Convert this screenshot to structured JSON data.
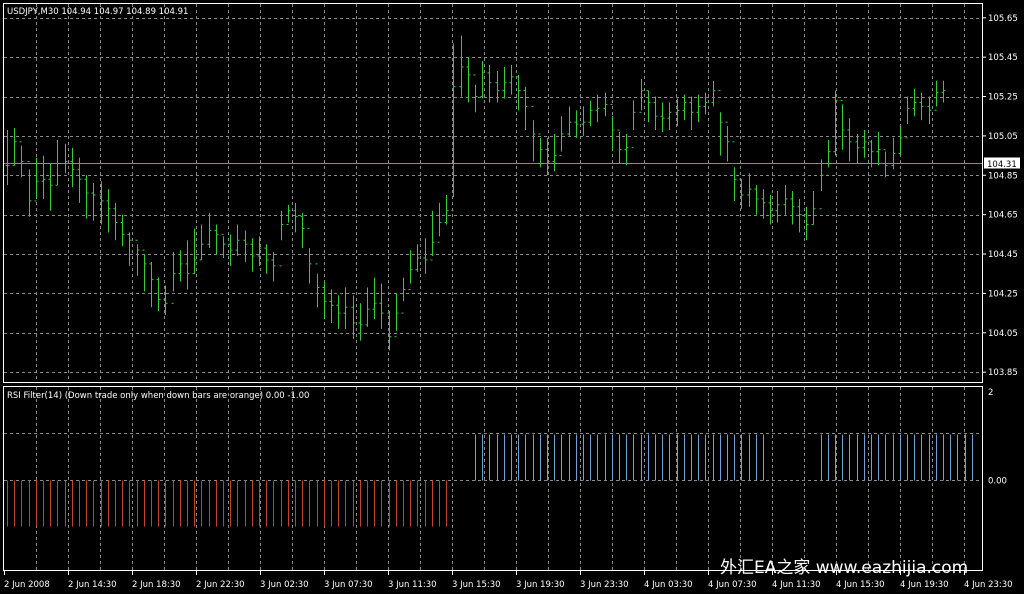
{
  "main_header": "USDJPY,M30  104.94 104.97 104.89 104.91",
  "indicator_header": "RSI Filter(14)  (Down trade only when down bars are orange) 0.00 -1.00",
  "current_price_label": "104.31",
  "watermark": "外汇EA之家 www.eazhijia.com",
  "colors": {
    "background": "#000000",
    "grid": "#8a8a8a",
    "price_bars": "#32cd32",
    "current_price_line": "#7a8fa0",
    "indicator_up": "#6fa3d8",
    "indicator_down": "#c0442a",
    "text": "#ffffff"
  },
  "chart_data": [
    {
      "type": "ohlc",
      "symbol": "USDJPY",
      "timeframe": "M30",
      "ylim": [
        103.8,
        105.72
      ],
      "y_ticks": [
        "105.65",
        "105.45",
        "105.25",
        "105.05",
        "104.85",
        "104.65",
        "104.45",
        "104.25",
        "104.05",
        "103.85"
      ],
      "x_ticks": [
        "2 Jun 2008",
        "2 Jun 14:30",
        "2 Jun 18:30",
        "2 Jun 22:30",
        "3 Jun 02:30",
        "3 Jun 07:30",
        "3 Jun 11:30",
        "3 Jun 15:30",
        "3 Jun 19:30",
        "3 Jun 23:30",
        "4 Jun 03:30",
        "4 Jun 07:30",
        "4 Jun 11:30",
        "4 Jun 15:30",
        "4 Jun 19:30",
        "4 Jun 23:30"
      ],
      "current_price": 104.91,
      "grid": true,
      "close": [
        104.9,
        105.02,
        104.92,
        104.72,
        104.82,
        104.83,
        104.8,
        104.91,
        104.92,
        104.88,
        104.83,
        104.76,
        104.75,
        104.72,
        104.68,
        104.61,
        104.55,
        104.52,
        104.47,
        104.4,
        104.32,
        104.22,
        104.2,
        104.35,
        104.4,
        104.35,
        104.42,
        104.5,
        104.57,
        104.55,
        104.5,
        104.47,
        104.52,
        104.5,
        104.44,
        104.48,
        104.42,
        104.39,
        104.6,
        104.67,
        104.64,
        104.58,
        104.4,
        104.28,
        104.21,
        104.19,
        104.15,
        104.18,
        104.1,
        104.09,
        104.17,
        104.2,
        104.15,
        104.03,
        104.15,
        104.27,
        104.37,
        104.43,
        104.42,
        104.51,
        104.61,
        104.67,
        105.3,
        105.4,
        105.36,
        105.25,
        105.37,
        105.32,
        105.28,
        105.32,
        105.35,
        105.28,
        105.2,
        105.06,
        104.98,
        104.92,
        104.95,
        105.06,
        105.12,
        105.11,
        105.12,
        105.18,
        105.19,
        105.21,
        105.08,
        104.98,
        104.99,
        105.17,
        105.28,
        105.22,
        105.15,
        105.14,
        105.17,
        105.18,
        105.22,
        105.17,
        105.2,
        105.22,
        105.28,
        105.12,
        105.02,
        104.83,
        104.75,
        104.78,
        104.73,
        104.71,
        104.67,
        104.7,
        104.73,
        104.69,
        104.65,
        104.6,
        104.68,
        104.85,
        104.97,
        105.23,
        105.08,
        105.02,
        104.99,
        105.02,
        104.97,
        104.98,
        104.9,
        104.96,
        105.04,
        105.19,
        105.22,
        105.2,
        105.18,
        105.27,
        105.28
      ],
      "high": [
        105.08,
        105.09,
        105.0,
        104.88,
        104.94,
        104.95,
        104.91,
        105.03,
        105.01,
        104.99,
        104.94,
        104.85,
        104.81,
        104.82,
        104.78,
        104.71,
        104.65,
        104.56,
        104.5,
        104.45,
        104.41,
        104.33,
        104.29,
        104.46,
        104.47,
        104.52,
        104.58,
        104.6,
        104.66,
        104.6,
        104.54,
        104.55,
        104.6,
        104.57,
        104.53,
        104.54,
        104.5,
        104.46,
        104.67,
        104.7,
        104.71,
        104.66,
        104.48,
        104.35,
        104.31,
        104.27,
        104.24,
        104.28,
        104.24,
        104.2,
        104.28,
        104.33,
        104.3,
        104.16,
        104.25,
        104.33,
        104.47,
        104.5,
        104.53,
        104.67,
        104.71,
        104.75,
        105.52,
        105.56,
        105.45,
        105.31,
        105.43,
        105.41,
        105.38,
        105.4,
        105.41,
        105.36,
        105.3,
        105.13,
        105.04,
        105.04,
        105.06,
        105.15,
        105.2,
        105.18,
        105.2,
        105.23,
        105.26,
        105.27,
        105.15,
        105.07,
        105.06,
        105.23,
        105.34,
        105.28,
        105.25,
        105.22,
        105.22,
        105.24,
        105.26,
        105.25,
        105.26,
        105.27,
        105.33,
        105.17,
        105.1,
        104.89,
        104.83,
        104.86,
        104.8,
        104.78,
        104.75,
        104.77,
        104.8,
        104.77,
        104.73,
        104.69,
        104.77,
        104.93,
        105.03,
        105.28,
        105.21,
        105.14,
        105.06,
        105.08,
        105.03,
        105.07,
        104.97,
        105.04,
        105.1,
        105.25,
        105.29,
        105.27,
        105.25,
        105.33,
        105.33
      ],
      "low": [
        104.8,
        104.9,
        104.84,
        104.64,
        104.73,
        104.73,
        104.67,
        104.8,
        104.86,
        104.79,
        104.71,
        104.63,
        104.62,
        104.6,
        104.56,
        104.52,
        104.49,
        104.39,
        104.34,
        104.26,
        104.18,
        104.16,
        104.14,
        104.26,
        104.31,
        104.27,
        104.35,
        104.42,
        104.48,
        104.45,
        104.43,
        104.39,
        104.44,
        104.41,
        104.36,
        104.39,
        104.35,
        104.31,
        104.52,
        104.61,
        104.56,
        104.48,
        104.3,
        104.18,
        104.12,
        104.1,
        104.07,
        104.07,
        104.02,
        104.01,
        104.08,
        104.12,
        104.07,
        103.96,
        104.06,
        104.21,
        104.3,
        104.36,
        104.35,
        104.44,
        104.54,
        104.6,
        104.74,
        105.25,
        105.22,
        105.17,
        105.24,
        105.22,
        105.22,
        105.24,
        105.26,
        105.18,
        105.08,
        104.92,
        104.89,
        104.85,
        104.87,
        104.97,
        105.05,
        105.04,
        105.05,
        105.1,
        105.12,
        105.15,
        104.98,
        104.91,
        104.9,
        105.08,
        105.18,
        105.12,
        105.08,
        105.07,
        105.08,
        105.1,
        105.13,
        105.08,
        105.12,
        105.16,
        105.2,
        104.95,
        104.92,
        104.72,
        104.68,
        104.69,
        104.65,
        104.63,
        104.6,
        104.61,
        104.65,
        104.6,
        104.56,
        104.52,
        104.6,
        104.77,
        104.89,
        104.95,
        104.98,
        104.92,
        104.91,
        104.94,
        104.89,
        104.9,
        104.84,
        104.88,
        104.95,
        105.11,
        105.15,
        105.13,
        105.11,
        105.2,
        105.22
      ]
    },
    {
      "type": "histogram",
      "title": "RSI Filter(14)",
      "y_ticks": [
        "2",
        "0.00"
      ],
      "ylim": [
        -1,
        2
      ],
      "bar_values": "down bars (orange) = -1.00 on bars 0-61, none on bars 62-64, up bars (blue) = +1.00 on bars 65-105, none on bars 106-112, up bars (blue) = +1.00 on bars 113-134",
      "orange_from": 0,
      "orange_to": 61,
      "blue_ranges": [
        [
          65,
          105
        ],
        [
          113,
          134
        ]
      ],
      "up_value": 1.0,
      "down_value": -1.0,
      "n_bars": 135
    }
  ]
}
